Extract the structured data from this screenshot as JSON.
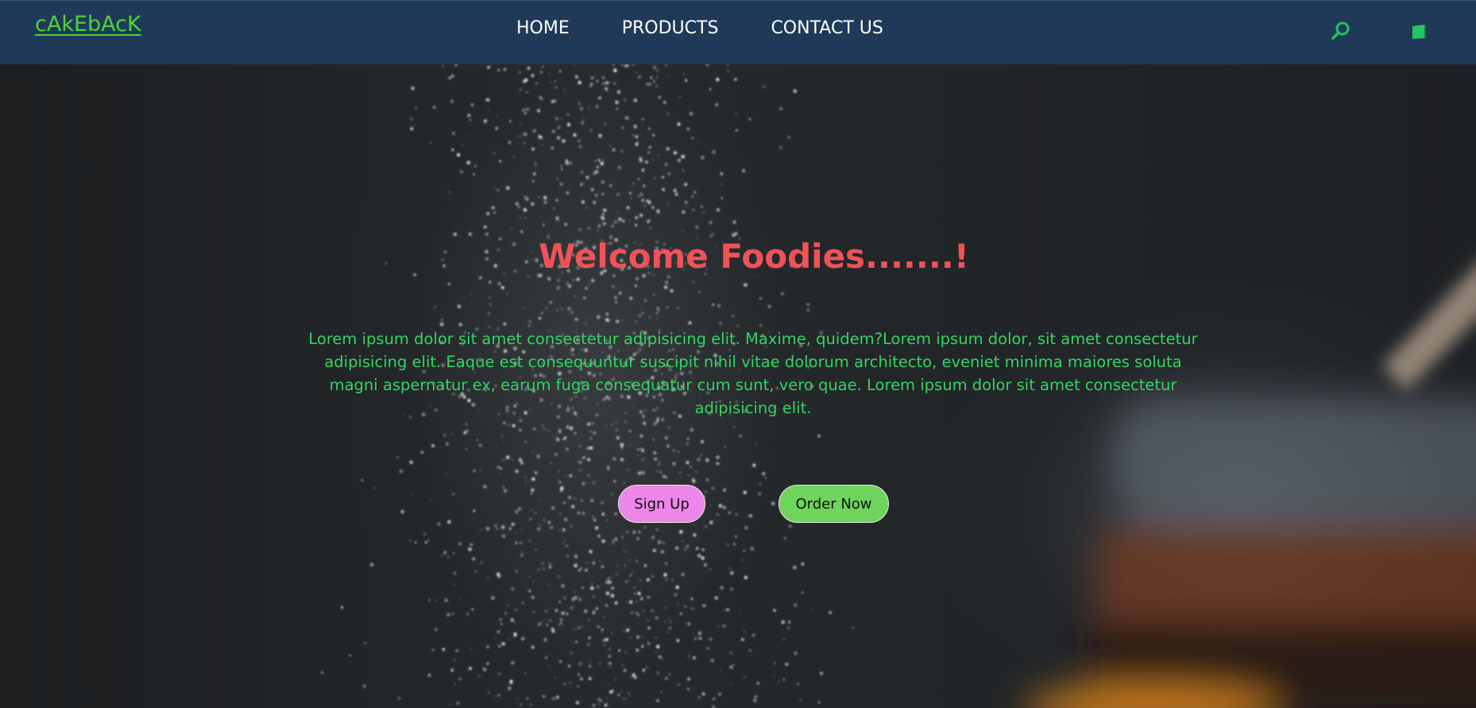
{
  "navbar": {
    "logo": "cAkEbAcK",
    "links": [
      {
        "label": "HOME"
      },
      {
        "label": "PRODUCTS"
      },
      {
        "label": "CONTACT US"
      }
    ],
    "search_icon": "search-icon",
    "cart_icon": "cart-icon",
    "icon_color": "#22c55e"
  },
  "hero": {
    "title": "Welcome Foodies.......!",
    "text": "Lorem ipsum dolor sit amet consectetur adipisicing elit. Maxime, quidem?Lorem ipsum dolor, sit amet consectetur adipisicing elit. Eaque est consequuntur suscipit nihil vitae dolorum architecto, eveniet minima maiores soluta magni aspernatur ex, earum fuga consequatur cum sunt, vero quae. Lorem ipsum dolor sit amet consectetur adipisicing elit.",
    "signup_label": "Sign Up",
    "order_label": "Order Now"
  },
  "colors": {
    "navbar_bg": "#1f3a59",
    "logo": "#4fd13c",
    "title": "#ef5358",
    "text": "#35d463",
    "signup_bg": "#ec86e8",
    "order_bg": "#6ed45c"
  }
}
